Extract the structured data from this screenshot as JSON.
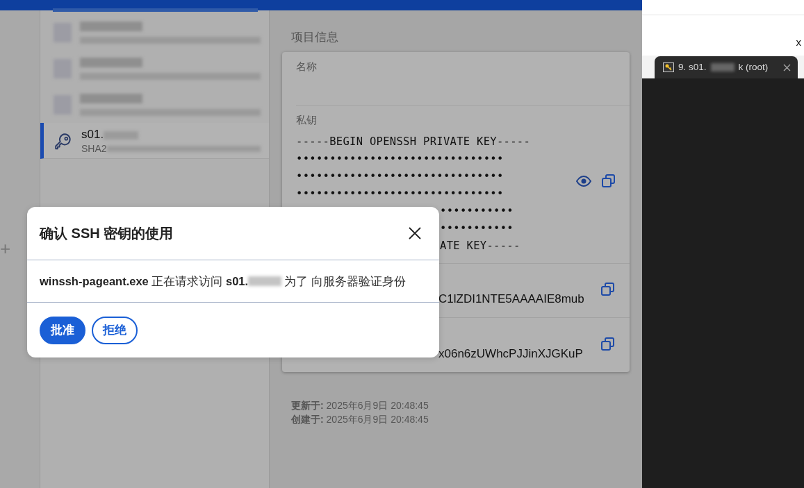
{
  "sidebar": {
    "add_label": "+"
  },
  "key_list": {
    "items": [
      {
        "kind": "blurred",
        "selected": false
      },
      {
        "kind": "blurred",
        "selected": false
      },
      {
        "kind": "blurred",
        "selected": false
      },
      {
        "kind": "key",
        "title": "s01.",
        "subtitle": "SHA2",
        "selected": true
      }
    ]
  },
  "details": {
    "heading": "项目信息",
    "fields": [
      {
        "kind": "name",
        "label": "名称"
      },
      {
        "kind": "private_key",
        "label": "私钥",
        "lines": [
          {
            "text": "-----BEGIN OPENSSH PRIVATE KEY-----",
            "partial": false
          },
          {
            "text": "•••••••••••••••••••••••••••••••",
            "partial": false
          },
          {
            "text": "•••••••••••••••••••••••••••••••",
            "partial": false
          },
          {
            "text": "•••••••••••••••••••••••••••••••",
            "partial": false
          },
          {
            "text": "•••••••••••",
            "partial": true
          },
          {
            "text": "•••••••••••",
            "partial": true
          },
          {
            "text": "ATE KEY-----",
            "partial": true
          }
        ]
      },
      {
        "kind": "value",
        "value": "C1lZDI1NTE5AAAAIE8mub"
      },
      {
        "kind": "value",
        "value": "x06n6zUWhcPJJinXJGKuP"
      }
    ],
    "updated": "**更新于:** 2025年6月9日 20:48:45",
    "created": "**创建于:** 2025年6月9日 20:48:45"
  },
  "terminal": {
    "stray_text": "x",
    "tab": {
      "title": "9. s01.",
      "suffix": "k (root)"
    }
  },
  "dialog": {
    "title": "确认 SSH 密钥的使用",
    "message_start": "**winssh-pageant.exe** 正在请求访问 **s01.**",
    "message_end": "为了 向服务器验证身份",
    "buttons": [
      {
        "label": "批准",
        "kind": "primary"
      },
      {
        "label": "拒绝",
        "kind": "outline"
      }
    ]
  }
}
